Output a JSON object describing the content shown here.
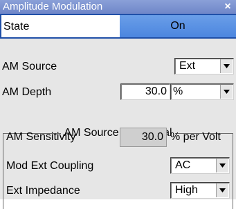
{
  "window": {
    "title": "Amplitude Modulation",
    "close_glyph": "×"
  },
  "state": {
    "label": "State",
    "value": "On"
  },
  "am_source": {
    "label": "AM Source",
    "value": "Ext"
  },
  "am_depth": {
    "label": "AM Depth",
    "value": "30.0",
    "unit": "%"
  },
  "group": {
    "title": "AM Source = External"
  },
  "am_sensitivity": {
    "label": "AM Sensitivity",
    "value": "30.0",
    "unit": "% per Volt"
  },
  "mod_ext_coupling": {
    "label": "Mod Ext Coupling",
    "value": "AC"
  },
  "ext_impedance": {
    "label": "Ext Impedance",
    "value": "High"
  },
  "colors": {
    "titlebar": "#6f86c8",
    "state_button": "#4c86df",
    "panel": "#e6e6e6",
    "focus_border": "#1f4fa8"
  },
  "icons": {
    "dropdown_arrow": "chevron-down-icon",
    "close": "close-icon"
  }
}
